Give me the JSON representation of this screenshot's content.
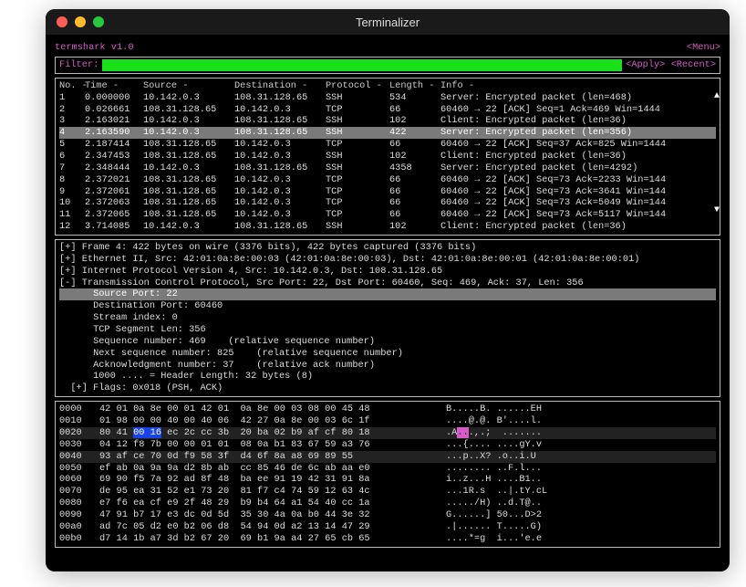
{
  "window": {
    "title": "Terminalizer"
  },
  "app": {
    "name": "termshark v1.0",
    "menu": "<Menu>"
  },
  "filter": {
    "label": "Filter:",
    "value": "",
    "apply": "<Apply>",
    "recent": "<Recent>"
  },
  "packet_list": {
    "columns": [
      "No. -",
      "Time -",
      "Source -",
      "Destination -",
      "Protocol -",
      "Length -",
      "Info -"
    ],
    "selected": 3,
    "rows": [
      {
        "no": "1",
        "time": "0.000000",
        "src": "10.142.0.3",
        "dst": "108.31.128.65",
        "proto": "SSH",
        "len": "534",
        "info": "Server: Encrypted packet (len=468)"
      },
      {
        "no": "2",
        "time": "0.026661",
        "src": "108.31.128.65",
        "dst": "10.142.0.3",
        "proto": "TCP",
        "len": "66",
        "info": "60460 → 22 [ACK] Seq=1 Ack=469 Win=1444"
      },
      {
        "no": "3",
        "time": "2.163021",
        "src": "10.142.0.3",
        "dst": "108.31.128.65",
        "proto": "SSH",
        "len": "102",
        "info": "Client: Encrypted packet (len=36)"
      },
      {
        "no": "4",
        "time": "2.163590",
        "src": "10.142.0.3",
        "dst": "108.31.128.65",
        "proto": "SSH",
        "len": "422",
        "info": "Server: Encrypted packet (len=356)"
      },
      {
        "no": "5",
        "time": "2.187414",
        "src": "108.31.128.65",
        "dst": "10.142.0.3",
        "proto": "TCP",
        "len": "66",
        "info": "60460 → 22 [ACK] Seq=37 Ack=825 Win=1444"
      },
      {
        "no": "6",
        "time": "2.347453",
        "src": "108.31.128.65",
        "dst": "10.142.0.3",
        "proto": "SSH",
        "len": "102",
        "info": "Client: Encrypted packet (len=36)"
      },
      {
        "no": "7",
        "time": "2.348444",
        "src": "10.142.0.3",
        "dst": "108.31.128.65",
        "proto": "SSH",
        "len": "4358",
        "info": "Server: Encrypted packet (len=4292)"
      },
      {
        "no": "8",
        "time": "2.372021",
        "src": "108.31.128.65",
        "dst": "10.142.0.3",
        "proto": "TCP",
        "len": "66",
        "info": "60460 → 22 [ACK] Seq=73 Ack=2233 Win=144"
      },
      {
        "no": "9",
        "time": "2.372061",
        "src": "108.31.128.65",
        "dst": "10.142.0.3",
        "proto": "TCP",
        "len": "66",
        "info": "60460 → 22 [ACK] Seq=73 Ack=3641 Win=144"
      },
      {
        "no": "10",
        "time": "2.372063",
        "src": "108.31.128.65",
        "dst": "10.142.0.3",
        "proto": "TCP",
        "len": "66",
        "info": "60460 → 22 [ACK] Seq=73 Ack=5049 Win=144"
      },
      {
        "no": "11",
        "time": "2.372065",
        "src": "108.31.128.65",
        "dst": "10.142.0.3",
        "proto": "TCP",
        "len": "66",
        "info": "60460 → 22 [ACK] Seq=73 Ack=5117 Win=144"
      },
      {
        "no": "12",
        "time": "3.714085",
        "src": "10.142.0.3",
        "dst": "108.31.128.65",
        "proto": "SSH",
        "len": "102",
        "info": "Client: Encrypted packet (len=36)"
      }
    ]
  },
  "details": {
    "selected": 4,
    "lines": [
      "[+] Frame 4: 422 bytes on wire (3376 bits), 422 bytes captured (3376 bits)",
      "[+] Ethernet II, Src: 42:01:0a:8e:00:03 (42:01:0a:8e:00:03), Dst: 42:01:0a:8e:00:01 (42:01:0a:8e:00:01)",
      "[+] Internet Protocol Version 4, Src: 10.142.0.3, Dst: 108.31.128.65",
      "[-] Transmission Control Protocol, Src Port: 22, Dst Port: 60460, Seq: 469, Ack: 37, Len: 356",
      "      Source Port: 22",
      "      Destination Port: 60460",
      "      Stream index: 0",
      "      TCP Segment Len: 356",
      "      Sequence number: 469    (relative sequence number)",
      "      Next sequence number: 825    (relative sequence number)",
      "      Acknowledgment number: 37    (relative ack number)",
      "      1000 .... = Header Length: 32 bytes (8)",
      "  [+] Flags: 0x018 (PSH, ACK)"
    ]
  },
  "hex": {
    "highlight_rows": [
      2,
      4
    ],
    "rows": [
      {
        "off": "0000",
        "b": "42 01 0a 8e 00 01 42 01  0a 8e 00 03 08 00 45 48",
        "a": "B.....B. ......EH"
      },
      {
        "off": "0010",
        "b": "01 98 00 00 40 00 40 06  42 27 0a 8e 00 03 6c 1f",
        "a": "....@.@. B'....l."
      },
      {
        "off": "0020",
        "b": "80 41 00 16 ec 2c cc 3b  20 ba 02 b9 af cf 80 18",
        "a": ".A...,.;  ......."
      },
      {
        "off": "0030",
        "b": "04 12 f8 7b 00 00 01 01  08 0a b1 83 67 59 a3 76",
        "a": "...{.... ....gY.v"
      },
      {
        "off": "0040",
        "b": "93 af ce 70 0d f9 58 3f  d4 6f 8a a8 69 89 55",
        "a": "...p..X? .o..i.U"
      },
      {
        "off": "0050",
        "b": "ef ab 0a 9a 9a d2 8b ab  cc 85 46 de 6c ab aa e0",
        "a": "........ ..F.l..."
      },
      {
        "off": "0060",
        "b": "69 90 f5 7a 92 ad 8f 48  ba ee 91 19 42 31 91 8a",
        "a": "i..z...H ....B1.."
      },
      {
        "off": "0070",
        "b": "de 95 ea 31 52 e1 73 20  81 f7 c4 74 59 12 63 4c",
        "a": "...1R.s  ..|.tY.cL"
      },
      {
        "off": "0080",
        "b": "e7 f6 ea cf e9 2f 48 29  b9 b4 64 a1 54 40 cc 1a",
        "a": "...../H) ..d.T@.."
      },
      {
        "off": "0090",
        "b": "47 91 b7 17 e3 dc 0d 5d  35 30 4a 0a b0 44 3e 32",
        "a": "G......] 50...D>2"
      },
      {
        "off": "00a0",
        "b": "ad 7c 05 d2 e0 b2 06 d8  54 94 0d a2 13 14 47 29",
        "a": ".|...... T.....G)"
      },
      {
        "off": "00b0",
        "b": "d7 14 1b a7 3d b2 67 20  69 b1 9a a4 27 65 cb 65",
        "a": "....*=g  i...'e.e"
      }
    ]
  }
}
